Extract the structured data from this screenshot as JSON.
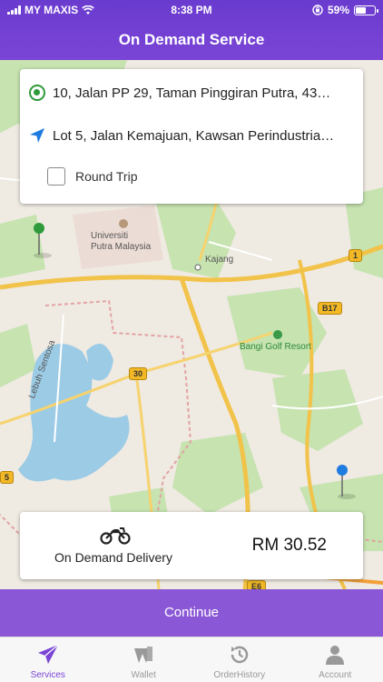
{
  "status_bar": {
    "carrier": "MY MAXIS",
    "time": "8:38 PM",
    "battery_percent": "59%",
    "battery_level": 0.59,
    "icons": [
      "signal-icon",
      "wifi-icon",
      "orientation-lock-icon",
      "battery-icon"
    ]
  },
  "header": {
    "title": "On Demand Service"
  },
  "route": {
    "origin": "10, Jalan PP 29, Taman Pinggiran Putra, 43…",
    "destination": "Lot 5, Jalan Kemajuan, Kawsan Perindustria…",
    "round_trip_label": "Round Trip",
    "round_trip_checked": false
  },
  "map": {
    "labels": {
      "upm_line1": "Universiti",
      "upm_line2": "Putra Malaysia",
      "kajang": "Kajang",
      "golf": "Bangi Golf Resort",
      "lebuh": "Lebuh Sentosa"
    },
    "road_badges": {
      "r1": "1",
      "b17": "B17",
      "r30": "30",
      "r5": "5",
      "e6": "E6"
    },
    "colors": {
      "origin_pin": "#2e9a3a",
      "destination_pin": "#1e7be0"
    }
  },
  "delivery": {
    "service_label": "On Demand Delivery",
    "price": "RM 30.52",
    "icon": "motorcycle-icon"
  },
  "continue_label": "Continue",
  "tabs": [
    {
      "label": "Services",
      "icon": "paper-plane-icon",
      "active": true
    },
    {
      "label": "Wallet",
      "icon": "wallet-icon",
      "active": false
    },
    {
      "label": "OrderHistory",
      "icon": "history-icon",
      "active": false
    },
    {
      "label": "Account",
      "icon": "user-icon",
      "active": false
    }
  ],
  "colors": {
    "brand_purple": "#7a45d6",
    "continue_bg": "#8a58d6"
  }
}
